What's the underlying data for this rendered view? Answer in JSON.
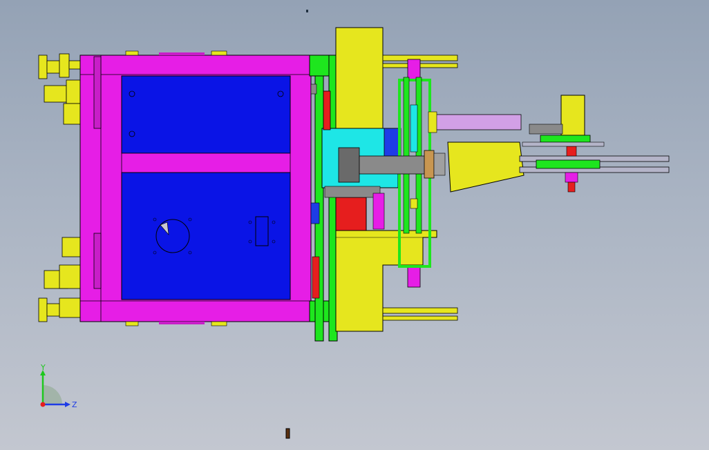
{
  "viewport": {
    "background_top": "#94a2b5",
    "background_bottom": "#c3c7d0"
  },
  "colors": {
    "frame": "#e61ee6",
    "panel": "#0a14e6",
    "yellow": "#e6e61e",
    "green": "#1ee61e",
    "cyan": "#1ee6e6",
    "red": "#e61e1e",
    "gray": "#8a8a8a",
    "lavender": "#d2a0e6",
    "outline": "#000000"
  },
  "triad": {
    "y_label": "Y",
    "z_label": "Z",
    "y_color": "#1ec81e",
    "z_color": "#1e3ce6",
    "origin_color": "#e61e1e"
  }
}
